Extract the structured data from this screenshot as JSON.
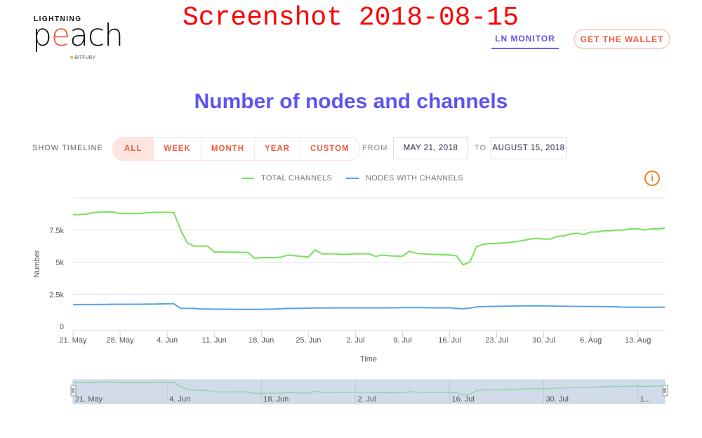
{
  "header": {
    "logo": {
      "top": "LIGHTNING",
      "main_pre": "p",
      "main_e": "e",
      "main_post": "ach",
      "sub": "BITFURY",
      "sub_mark": "a"
    },
    "stamp": "Screenshot 2018-08-15",
    "nav_monitor": "LN MONITOR",
    "wallet_button": "GET THE WALLET"
  },
  "page_title": "Number of nodes and channels",
  "timeline": {
    "label": "SHOW TIMELINE",
    "buttons": [
      "ALL",
      "WEEK",
      "MONTH",
      "YEAR",
      "CUSTOM"
    ],
    "active": "ALL",
    "from_label": "FROM",
    "from_value": "MAY 21, 2018",
    "to_label": "TO",
    "to_value": "AUGUST 15, 2018"
  },
  "info_icon": "i",
  "colors": {
    "accent": "#5c55f0",
    "peach": "#f05a3a",
    "green": "#77e05a",
    "blue": "#5aa0ea",
    "navigator_fill": "#d1dbe9"
  },
  "chart_data": {
    "type": "line",
    "title": "Number of nodes and channels",
    "xlabel": "Time",
    "ylabel": "Number",
    "ylim": [
      0,
      10000
    ],
    "yticks": [
      0,
      2500,
      5000,
      7500
    ],
    "ytick_labels": [
      "0",
      "2.5k",
      "5k",
      "7.5k"
    ],
    "x_start": "2018-05-21",
    "x_end": "2018-08-15",
    "xtick_labels": [
      "21. May",
      "28. May",
      "4. Jun",
      "11. Jun",
      "18. Jun",
      "25. Jun",
      "2. Jul",
      "9. Jul",
      "16. Jul",
      "23. Jul",
      "30. Jul",
      "6. Aug",
      "13. Aug"
    ],
    "grid": true,
    "legend_position": "top-center",
    "series": [
      {
        "name": "TOTAL CHANNELS",
        "color": "#77e05a",
        "values": [
          8700,
          8700,
          8750,
          8850,
          8900,
          8900,
          8900,
          8780,
          8780,
          8780,
          8780,
          8850,
          8880,
          8880,
          8880,
          8860,
          7500,
          6500,
          6250,
          6250,
          6250,
          5800,
          5780,
          5780,
          5780,
          5760,
          5760,
          5300,
          5350,
          5350,
          5350,
          5400,
          5550,
          5500,
          5450,
          5400,
          5950,
          5650,
          5650,
          5650,
          5600,
          5620,
          5650,
          5650,
          5650,
          5450,
          5550,
          5500,
          5470,
          5470,
          5850,
          5700,
          5650,
          5620,
          5600,
          5580,
          5560,
          5500,
          4800,
          5000,
          6200,
          6400,
          6450,
          6450,
          6500,
          6550,
          6600,
          6700,
          6800,
          6850,
          6800,
          6800,
          7000,
          7050,
          7200,
          7250,
          7150,
          7350,
          7350,
          7450,
          7450,
          7500,
          7500,
          7600,
          7600,
          7500,
          7600,
          7600,
          7650
        ]
      },
      {
        "name": "NODES WITH CHANNELS",
        "color": "#5aa0ea",
        "values": [
          1700,
          1700,
          1700,
          1700,
          1710,
          1710,
          1720,
          1720,
          1720,
          1720,
          1720,
          1730,
          1740,
          1750,
          1760,
          1760,
          1410,
          1400,
          1400,
          1350,
          1350,
          1340,
          1340,
          1340,
          1330,
          1330,
          1330,
          1320,
          1330,
          1340,
          1350,
          1380,
          1400,
          1400,
          1410,
          1420,
          1430,
          1430,
          1430,
          1440,
          1440,
          1440,
          1440,
          1440,
          1440,
          1440,
          1440,
          1450,
          1450,
          1460,
          1460,
          1460,
          1460,
          1450,
          1450,
          1450,
          1450,
          1400,
          1370,
          1420,
          1520,
          1540,
          1550,
          1560,
          1570,
          1580,
          1590,
          1600,
          1600,
          1600,
          1600,
          1590,
          1570,
          1570,
          1560,
          1560,
          1550,
          1550,
          1540,
          1540,
          1530,
          1520,
          1500,
          1500,
          1490,
          1490,
          1490,
          1490,
          1500
        ]
      }
    ],
    "navigator": {
      "xtick_labels": [
        "21. May",
        "4. Jun",
        "18. Jun",
        "2. Jul",
        "16. Jul",
        "30. Jul",
        "1..."
      ]
    }
  }
}
